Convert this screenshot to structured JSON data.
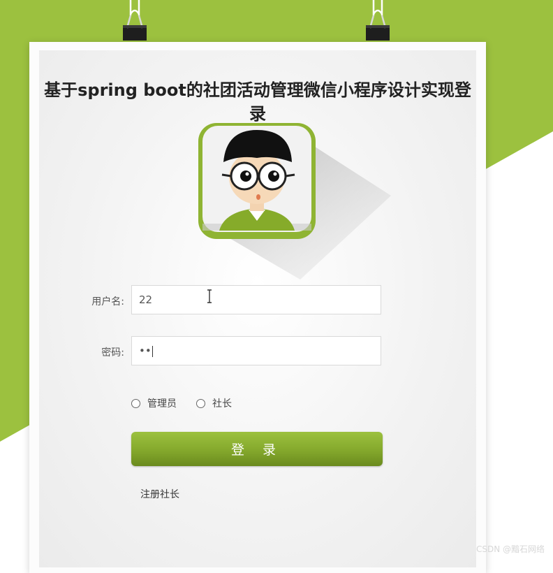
{
  "page": {
    "title": "基于spring boot的社团活动管理微信小程序设计实现登录"
  },
  "form": {
    "username_label": "用户名:",
    "username_value": "22",
    "password_label": "密码:",
    "password_value": "••"
  },
  "roles": [
    {
      "label": "管理员",
      "selected": false
    },
    {
      "label": "社长",
      "selected": false
    }
  ],
  "login_button": "登 录",
  "register_link": "注册社长",
  "watermark": "CSDN @黯石网络",
  "colors": {
    "accent_green": "#9cc13f",
    "button_dark": "#6a8a1e"
  },
  "icons": {
    "avatar": "cartoon-boy-avatar-icon",
    "text_cursor": "ibeam-cursor-icon",
    "binder_clip": "binder-clip-icon"
  }
}
